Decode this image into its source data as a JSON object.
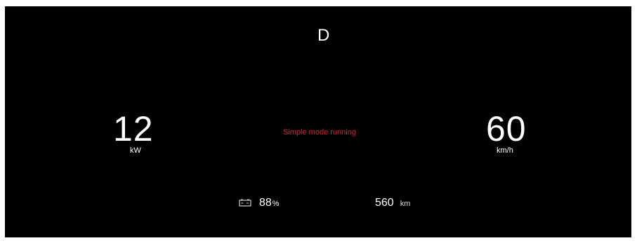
{
  "drive": {
    "gear": "D",
    "status_message": "Simple mode running"
  },
  "power": {
    "value": "12",
    "unit": "kW"
  },
  "speed": {
    "value": "60",
    "unit": "km/h"
  },
  "battery": {
    "percent": "88",
    "unit": "%",
    "icon": "battery-icon"
  },
  "range": {
    "value": "560",
    "unit": "km"
  },
  "colors": {
    "background": "#000000",
    "text": "#ffffff",
    "status": "#e0202a"
  }
}
